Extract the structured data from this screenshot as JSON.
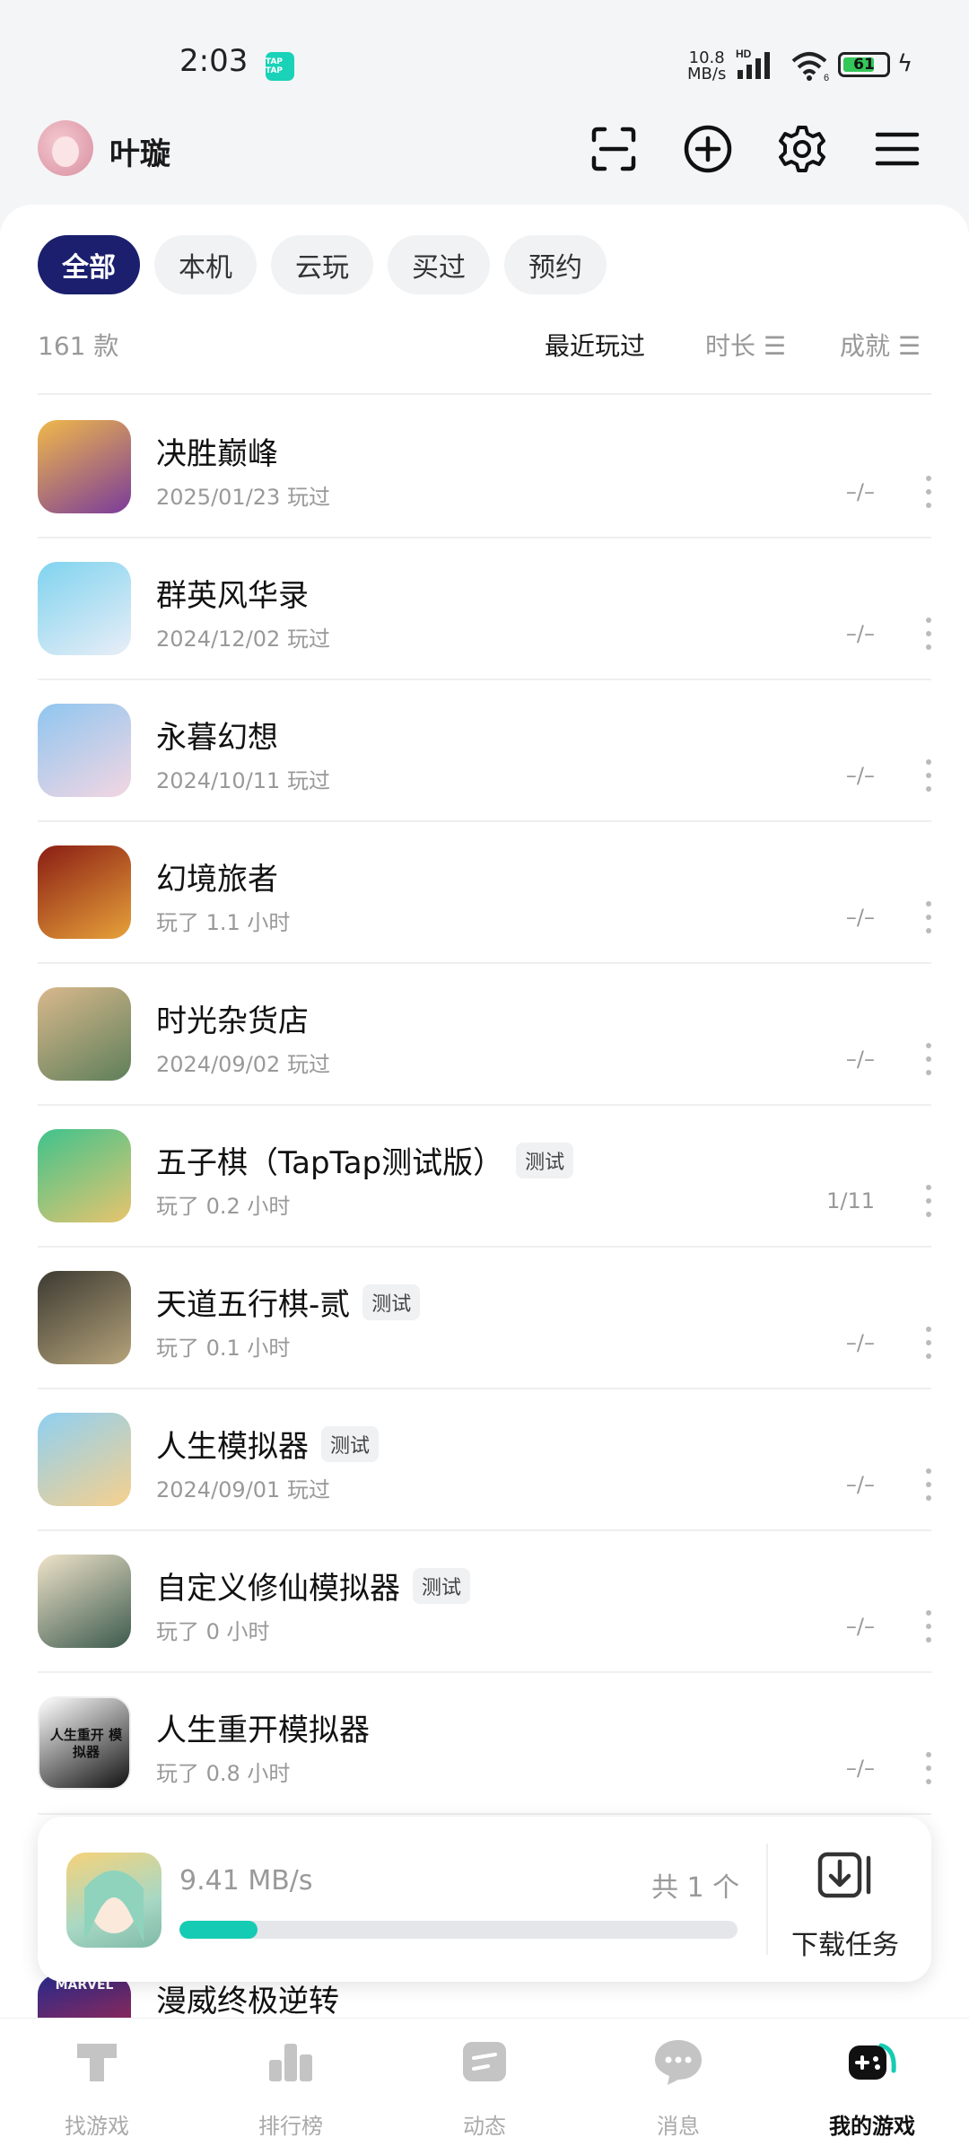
{
  "status_bar": {
    "time": "2:03",
    "app_badge": "TAP TAP",
    "net_speed_value": "10.8",
    "net_speed_unit": "MB/s",
    "signal_label": "HD",
    "wifi_label": "6",
    "battery": "61"
  },
  "header": {
    "username": "叶璇"
  },
  "filters": [
    {
      "label": "全部",
      "active": true
    },
    {
      "label": "本机",
      "active": false
    },
    {
      "label": "云玩",
      "active": false
    },
    {
      "label": "买过",
      "active": false
    },
    {
      "label": "预约",
      "active": false
    }
  ],
  "list_meta": {
    "count": "161 款",
    "sort_recent": "最近玩过",
    "sort_duration": "时长 ☰",
    "sort_achievement": "成就 ☰"
  },
  "games": [
    {
      "name": "决胜巅峰",
      "badge": "",
      "sub": "2025/01/23 玩过",
      "achievement": "–/–",
      "icon_colors": [
        "#f0b94a",
        "#7a3b9a"
      ]
    },
    {
      "name": "群英风华录",
      "badge": "",
      "sub": "2024/12/02 玩过",
      "achievement": "–/–",
      "icon_colors": [
        "#7fd3ef",
        "#e9eef7"
      ]
    },
    {
      "name": "永暮幻想",
      "badge": "",
      "sub": "2024/10/11 玩过",
      "achievement": "–/–",
      "icon_colors": [
        "#8fc6f0",
        "#f3d6e2"
      ]
    },
    {
      "name": "幻境旅者",
      "badge": "",
      "sub": "玩了 1.1 小时",
      "achievement": "–/–",
      "icon_colors": [
        "#8a1d14",
        "#e7a23a"
      ]
    },
    {
      "name": "时光杂货店",
      "badge": "",
      "sub": "2024/09/02 玩过",
      "achievement": "–/–",
      "icon_colors": [
        "#d9b88c",
        "#5e7f5a"
      ]
    },
    {
      "name": "五子棋（TapTap测试版）",
      "badge": "测试",
      "sub": "玩了 0.2 小时",
      "achievement": "1/11",
      "icon_colors": [
        "#3fc38c",
        "#e8c46e"
      ]
    },
    {
      "name": "天道五行棋-贰",
      "badge": "测试",
      "sub": "玩了 0.1 小时",
      "achievement": "–/–",
      "icon_colors": [
        "#3c3a32",
        "#b5a37a"
      ]
    },
    {
      "name": "人生模拟器",
      "badge": "测试",
      "sub": "2024/09/01 玩过",
      "achievement": "–/–",
      "icon_colors": [
        "#8fd0f2",
        "#f6d08d"
      ]
    },
    {
      "name": "自定义修仙模拟器",
      "badge": "测试",
      "sub": "玩了 0 小时",
      "achievement": "–/–",
      "icon_colors": [
        "#efe3c9",
        "#3c5a4e"
      ]
    },
    {
      "name": "人生重开模拟器",
      "badge": "",
      "sub": "玩了 0.8 小时",
      "achievement": "–/–",
      "icon_colors": [
        "#ffffff",
        "#111111"
      ],
      "icon_text": "人生重开 模拟器"
    }
  ],
  "partial_game": {
    "name": "漫威终极逆转",
    "icon_label": "MARVEL"
  },
  "download": {
    "speed": "9.41 MB/s",
    "total": "共 1 个",
    "progress": 0.14,
    "tasks_label": "下载任务"
  },
  "nav": [
    {
      "label": "找游戏",
      "icon": "find-games-icon",
      "active": false
    },
    {
      "label": "排行榜",
      "icon": "ranking-icon",
      "active": false
    },
    {
      "label": "动态",
      "icon": "feed-icon",
      "active": false
    },
    {
      "label": "消息",
      "icon": "message-icon",
      "active": false
    },
    {
      "label": "我的游戏",
      "icon": "gamepad-icon",
      "active": true
    }
  ],
  "colors": {
    "accent": "#1b1f6e",
    "teal": "#16cbb3",
    "muted": "#999999"
  }
}
